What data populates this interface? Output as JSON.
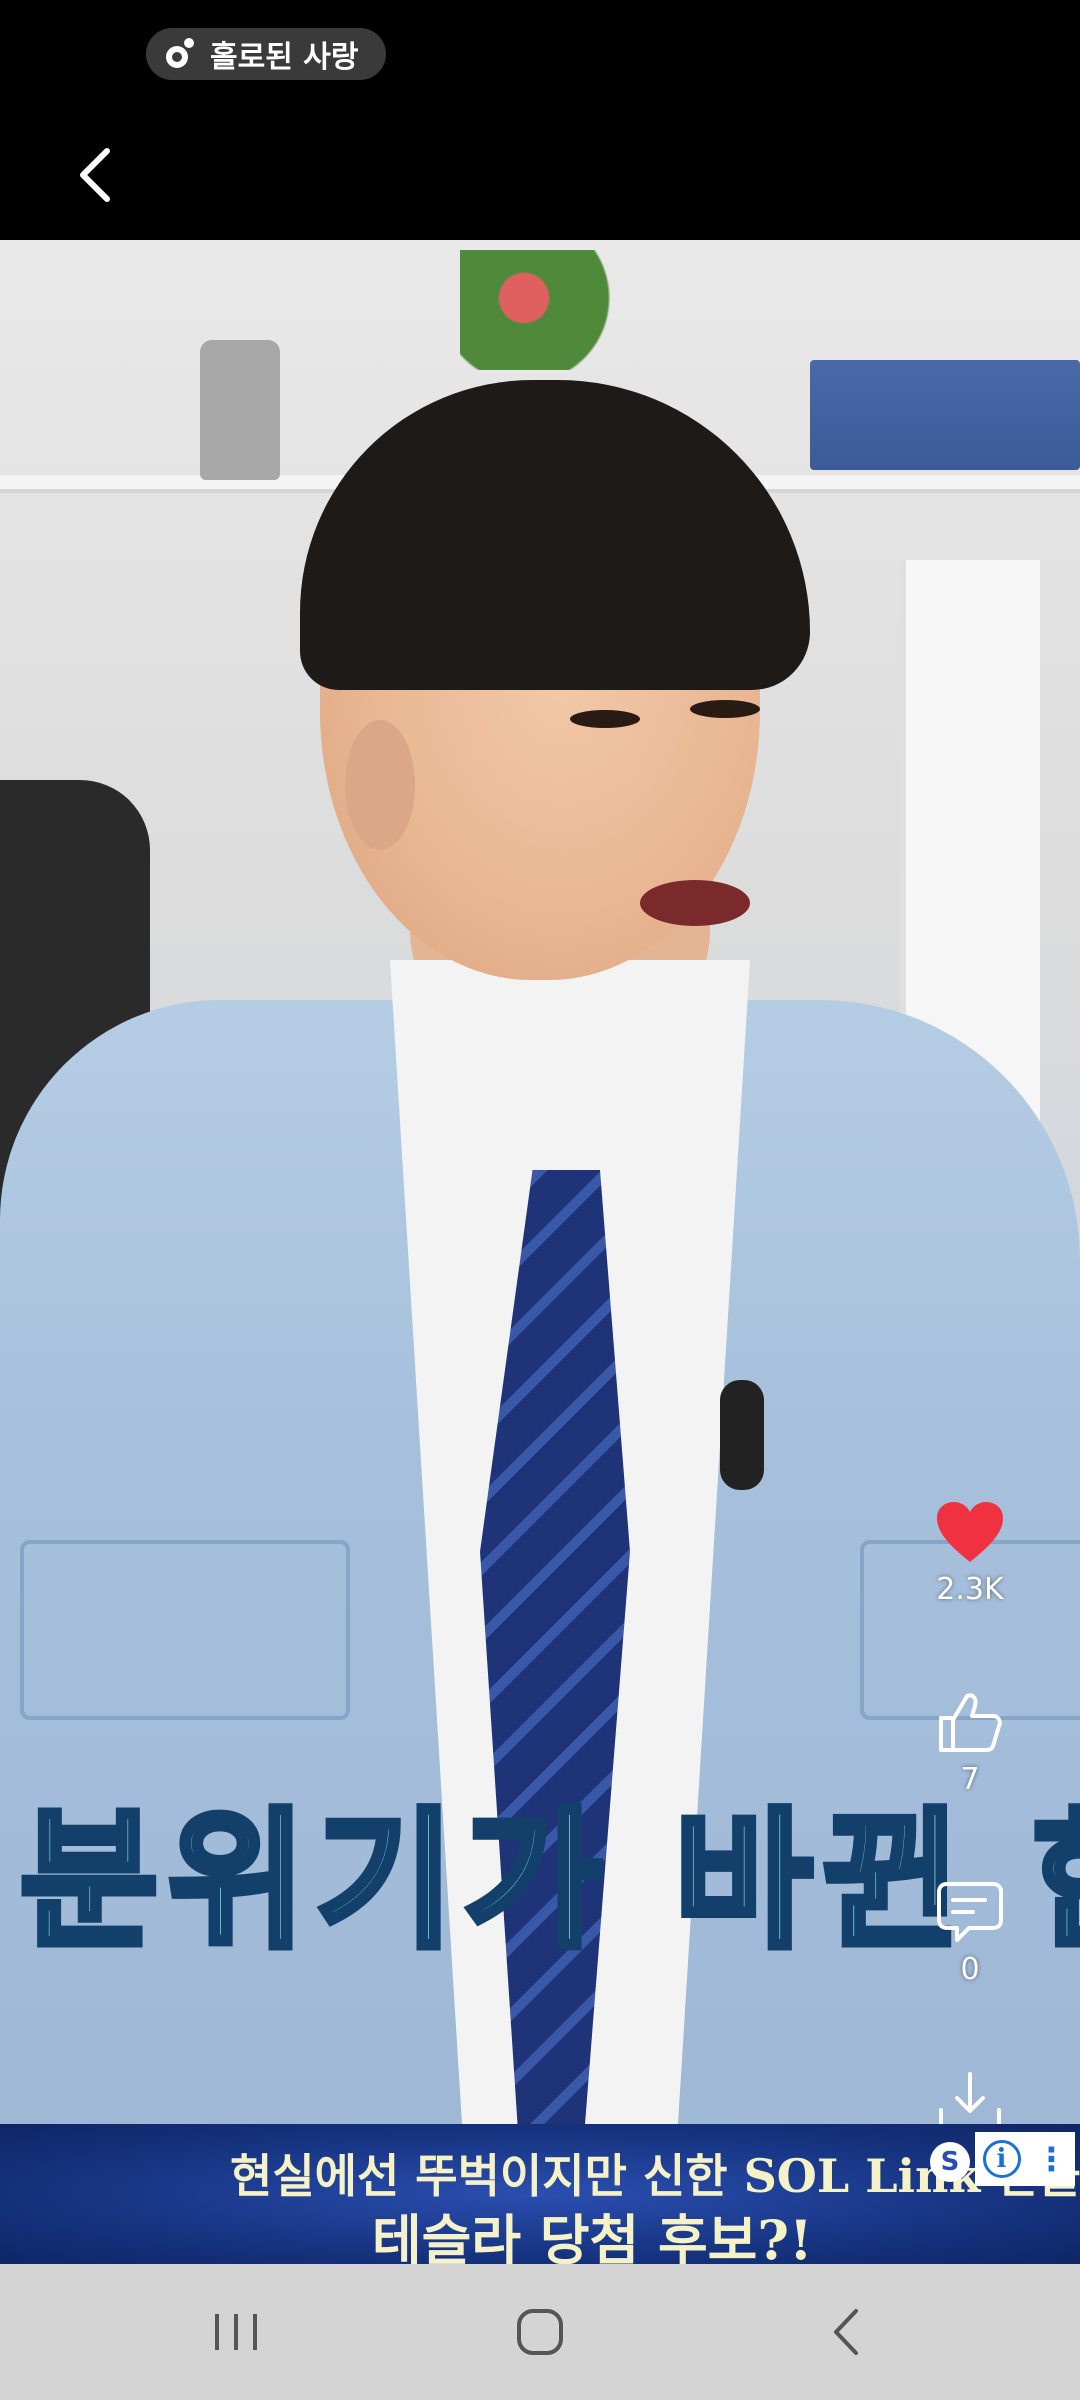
{
  "status_bar": {
    "media_pill_label": "홀로된 사랑",
    "media_icon": "music-icon"
  },
  "top_bar": {
    "back_icon": "chevron-left-icon"
  },
  "video": {
    "caption": "분위기가 바뀐 한"
  },
  "actions": {
    "like": {
      "icon": "heart-icon",
      "count": "2.3K",
      "color": "#f0313f"
    },
    "thumbs_up": {
      "icon": "thumbs-up-icon",
      "count": "7"
    },
    "comment": {
      "icon": "comment-icon",
      "count": "0"
    },
    "download": {
      "icon": "download-icon"
    },
    "share": {
      "icon": "share-icon"
    }
  },
  "ad": {
    "line1": "현실에선 뚜벅이지만 신한 SOL Link 만들고",
    "line2": "테슬라 당첨 후보?!",
    "badge": "S",
    "info_label": "i",
    "more_label": "⋮"
  },
  "nav_bar": {
    "recents_icon": "recents-icon",
    "home_icon": "home-icon",
    "back_icon": "back-icon"
  }
}
